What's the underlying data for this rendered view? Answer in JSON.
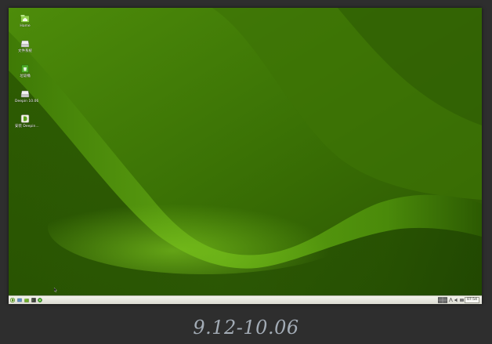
{
  "caption": "9.12-10.06",
  "desktop": {
    "icons": [
      {
        "label": "Home",
        "icon": "home-folder-icon"
      },
      {
        "label": "文件系统",
        "icon": "drive-icon"
      },
      {
        "label": "垃圾桶",
        "icon": "trash-icon"
      },
      {
        "label": "Deepin 10.06",
        "icon": "disc-drive-icon"
      },
      {
        "label": "安装 Deepin...",
        "icon": "deepin-install-icon"
      }
    ]
  },
  "taskbar": {
    "clock": "07:54",
    "launchers": [
      "deepin-menu-icon",
      "show-desktop-icon",
      "file-manager-icon",
      "terminal-icon",
      "browser-icon"
    ],
    "tray": [
      "workspace-switcher-icon",
      "network-icon",
      "volume-icon",
      "keyboard-icon",
      "battery-icon"
    ]
  },
  "colors": {
    "wallpaper_dark": "#2f5e02",
    "wallpaper_light": "#6cb514",
    "taskbar": "#ebebe3",
    "caption": "#a3acb6"
  }
}
